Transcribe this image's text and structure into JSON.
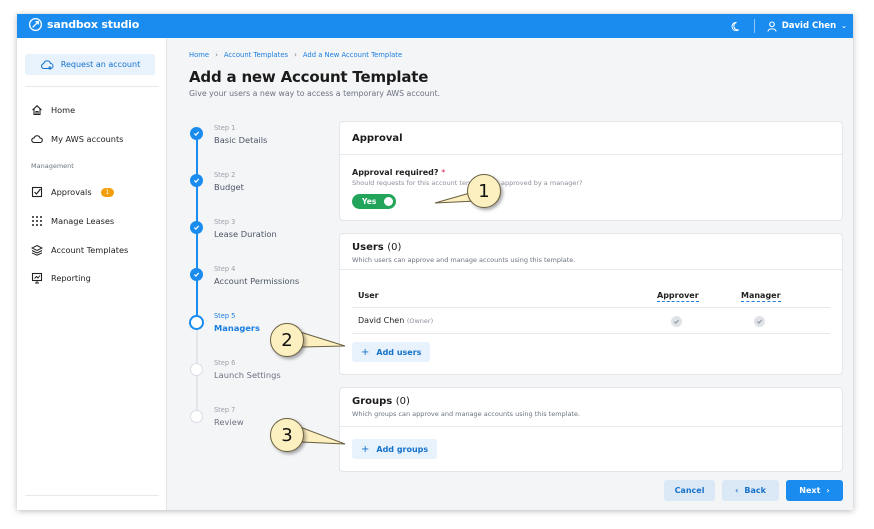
{
  "app": {
    "name": "sandbox studio",
    "user": "David Chen"
  },
  "sidebar": {
    "request_button": "Request an account",
    "nav": [
      {
        "label": "Home",
        "icon": "home-icon"
      },
      {
        "label": "My AWS accounts",
        "icon": "cloud-icon"
      }
    ],
    "section_label": "Management",
    "management": [
      {
        "label": "Approvals",
        "icon": "checkbox-icon",
        "badge": "1"
      },
      {
        "label": "Manage Leases",
        "icon": "grid-dots-icon"
      },
      {
        "label": "Account Templates",
        "icon": "layers-icon"
      },
      {
        "label": "Reporting",
        "icon": "report-icon"
      }
    ]
  },
  "breadcrumb": [
    "Home",
    "Account Templates",
    "Add a New Account Template"
  ],
  "page": {
    "title": "Add a new Account Template",
    "subtitle": "Give your users a new way to access a temporary AWS account."
  },
  "steps": [
    {
      "label": "Step 1",
      "name": "Basic Details",
      "state": "done"
    },
    {
      "label": "Step 2",
      "name": "Budget",
      "state": "done"
    },
    {
      "label": "Step 3",
      "name": "Lease Duration",
      "state": "done"
    },
    {
      "label": "Step 4",
      "name": "Account Permissions",
      "state": "done"
    },
    {
      "label": "Step 5",
      "name": "Managers",
      "state": "active"
    },
    {
      "label": "Step 6",
      "name": "Launch Settings",
      "state": "future"
    },
    {
      "label": "Step 7",
      "name": "Review",
      "state": "future"
    }
  ],
  "approval": {
    "title": "Approval",
    "field_label": "Approval required?",
    "required_mark": "*",
    "help": "Should requests for this account template be approved by a manager?",
    "toggle_label": "Yes"
  },
  "users": {
    "title": "Users",
    "count": "(0)",
    "description": "Which users can approve and manage accounts using this template.",
    "columns": [
      "User",
      "Approver",
      "Manager"
    ],
    "rows": [
      {
        "name": "David Chen",
        "tag": "(Owner)"
      }
    ],
    "add_button": "Add users"
  },
  "groups": {
    "title": "Groups",
    "count": "(0)",
    "description": "Which groups can approve and manage accounts using this template.",
    "add_button": "Add groups"
  },
  "footer": {
    "cancel": "Cancel",
    "back": "Back",
    "next": "Next"
  },
  "callouts": [
    "1",
    "2",
    "3"
  ],
  "colors": {
    "primary": "#1a8cf0",
    "success": "#22a55a",
    "badge": "#f59e0b",
    "callout": "#fcefc0"
  }
}
